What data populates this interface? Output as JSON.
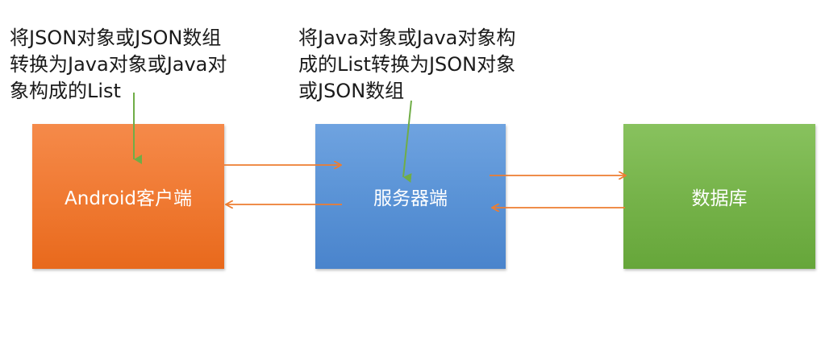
{
  "notes": {
    "left": "将JSON对象或JSON数组\n转换为Java对象或Java对\n象构成的List",
    "right": "将Java对象或Java对象构\n成的List转换为JSON对象\n或JSON数组"
  },
  "nodes": {
    "android": "Android客户端",
    "server": "服务器端",
    "database": "数据库"
  },
  "colors": {
    "android": "#f07a33",
    "server": "#5a93d6",
    "database": "#76b34a",
    "flow_arrow": "#ed7d31",
    "note_arrow": "#70ad47"
  }
}
